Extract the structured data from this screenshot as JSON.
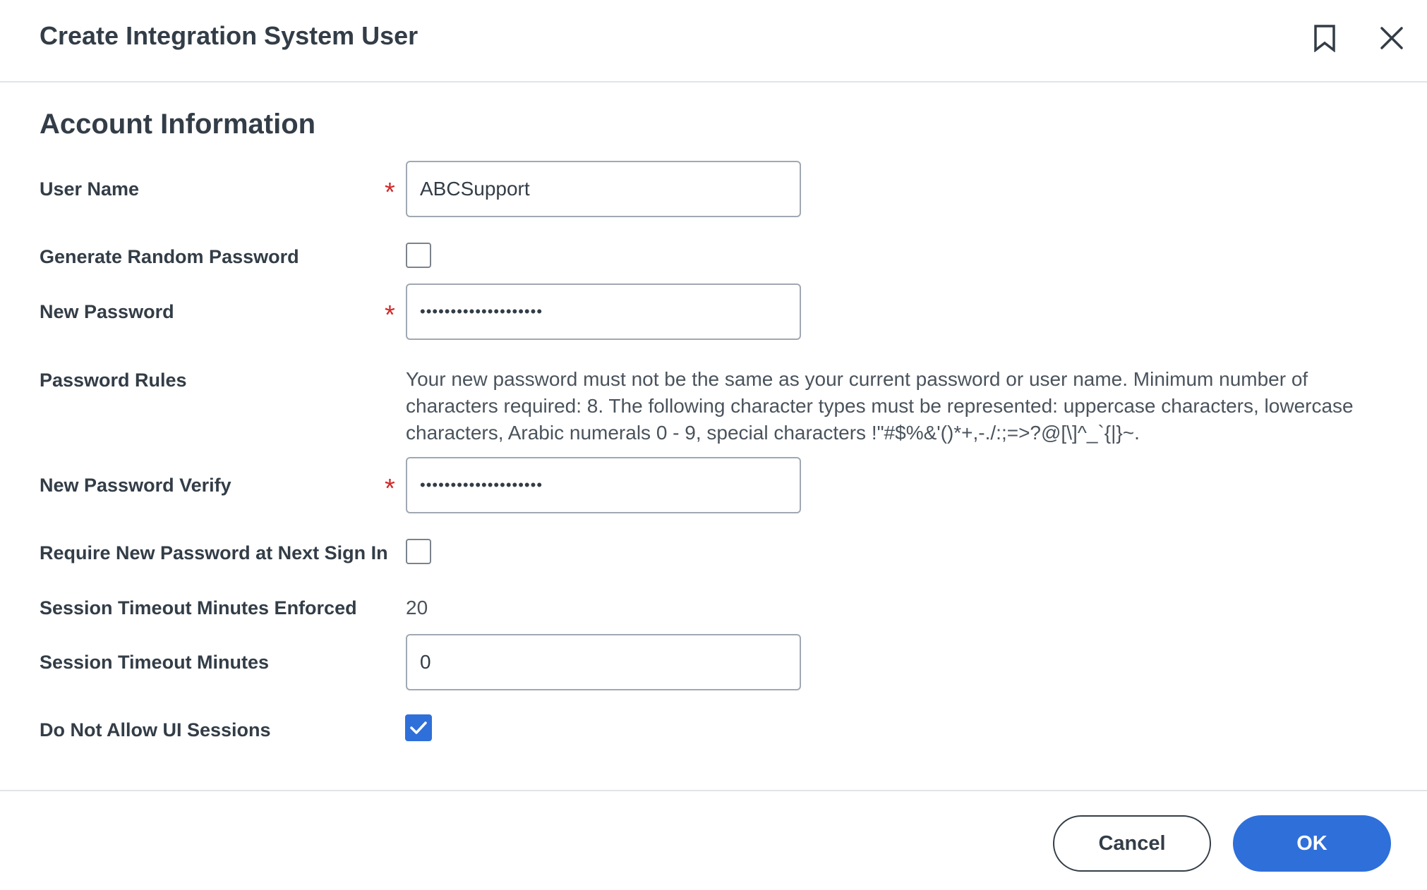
{
  "dialog": {
    "title": "Create Integration System User",
    "icons": {
      "bookmark": "bookmark-icon",
      "close": "close-icon"
    }
  },
  "section": {
    "title": "Account Information"
  },
  "fields": {
    "user_name": {
      "label": "User Name",
      "value": "ABCSupport",
      "required_mark": "*"
    },
    "generate_random_password": {
      "label": "Generate Random Password",
      "checked": false
    },
    "new_password": {
      "label": "New Password",
      "value": "••••••••••••••••••••",
      "required_mark": "*"
    },
    "password_rules": {
      "label": "Password Rules",
      "text": "Your new password must not be the same as your current password or user name. Minimum number of characters required: 8. The following character types must be represented: uppercase characters, lowercase characters, Arabic numerals 0 - 9, special characters !\"#$%&'()*+,-./:;=>?@[\\]^_`{|}~."
    },
    "new_password_verify": {
      "label": "New Password Verify",
      "value": "••••••••••••••••••••",
      "required_mark": "*"
    },
    "require_new_password": {
      "label": "Require New Password at Next Sign In",
      "checked": false
    },
    "session_timeout_enforced": {
      "label": "Session Timeout Minutes Enforced",
      "value": "20"
    },
    "session_timeout_minutes": {
      "label": "Session Timeout Minutes",
      "value": "0"
    },
    "do_not_allow_ui_sessions": {
      "label": "Do Not Allow UI Sessions",
      "checked": true
    }
  },
  "footer": {
    "cancel_label": "Cancel",
    "ok_label": "OK"
  },
  "colors": {
    "accent": "#2f6fd9",
    "required": "#d22a2a",
    "text": "#333d47"
  }
}
